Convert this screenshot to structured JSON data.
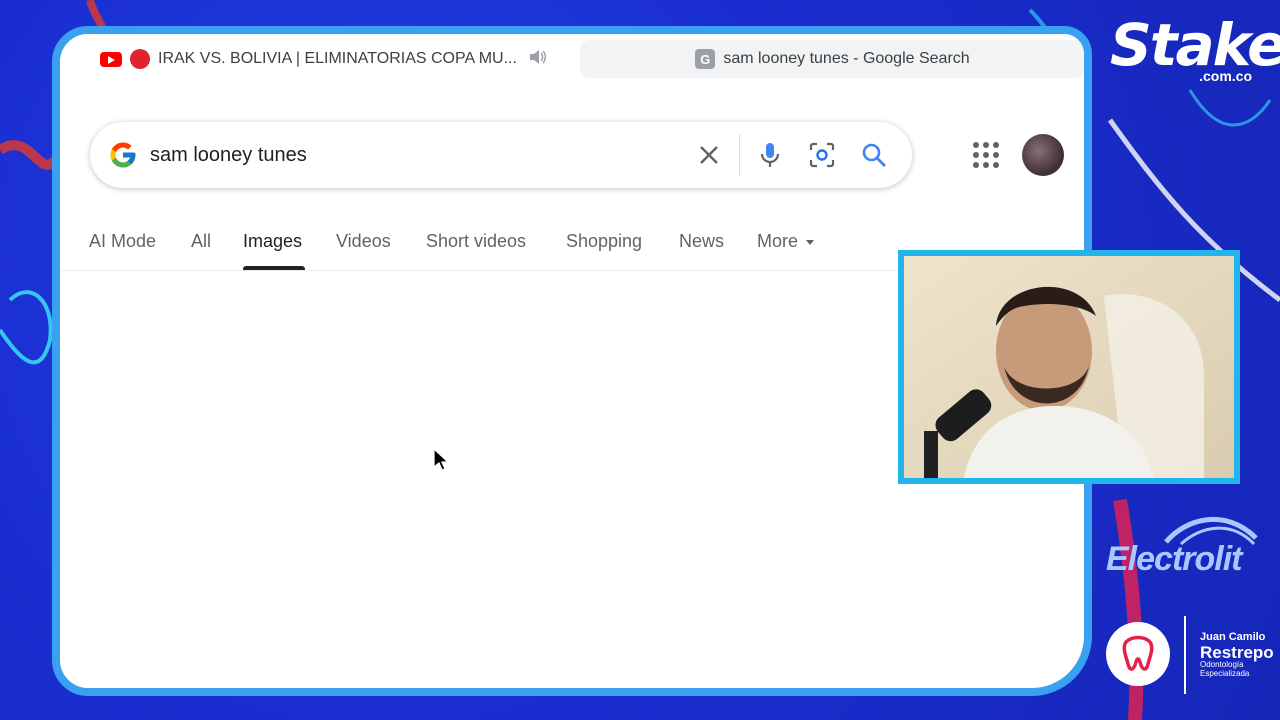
{
  "browser": {
    "tabs": [
      {
        "title": "IRAK VS. BOLIVIA | ELIMINATORIAS COPA MU...",
        "icon": "youtube-icon",
        "state": "inactive",
        "audio": "speaker-icon"
      },
      {
        "title": "sam looney tunes - Google Search",
        "icon": "google-favicon",
        "state": "active"
      }
    ]
  },
  "search": {
    "query": "sam looney tunes",
    "icons": [
      "google-logo",
      "clear-icon",
      "microphone-icon",
      "camera-lens-icon",
      "search-icon"
    ]
  },
  "nav": {
    "items": [
      {
        "label": "AI Mode",
        "active": false
      },
      {
        "label": "All",
        "active": false
      },
      {
        "label": "Images",
        "active": true
      },
      {
        "label": "Videos",
        "active": false
      },
      {
        "label": "Short videos",
        "active": false
      },
      {
        "label": "Shopping",
        "active": false
      },
      {
        "label": "News",
        "active": false
      },
      {
        "label": "More",
        "active": false
      }
    ]
  },
  "overlay": {
    "stake": {
      "name": "Stake",
      "domain": ".com.co"
    },
    "sponsor2": {
      "name": "Electrolit"
    },
    "sponsor3": {
      "name_line1": "Juan Camilo",
      "name_line2": "Restrepo",
      "subtitle_line1": "Odontología",
      "subtitle_line2": "Especializada"
    }
  },
  "colors": {
    "background": "#1a2fd6",
    "frame_border": "#3aa0f0",
    "webcam_border": "#22b4ea",
    "live_red": "#e0242c"
  }
}
